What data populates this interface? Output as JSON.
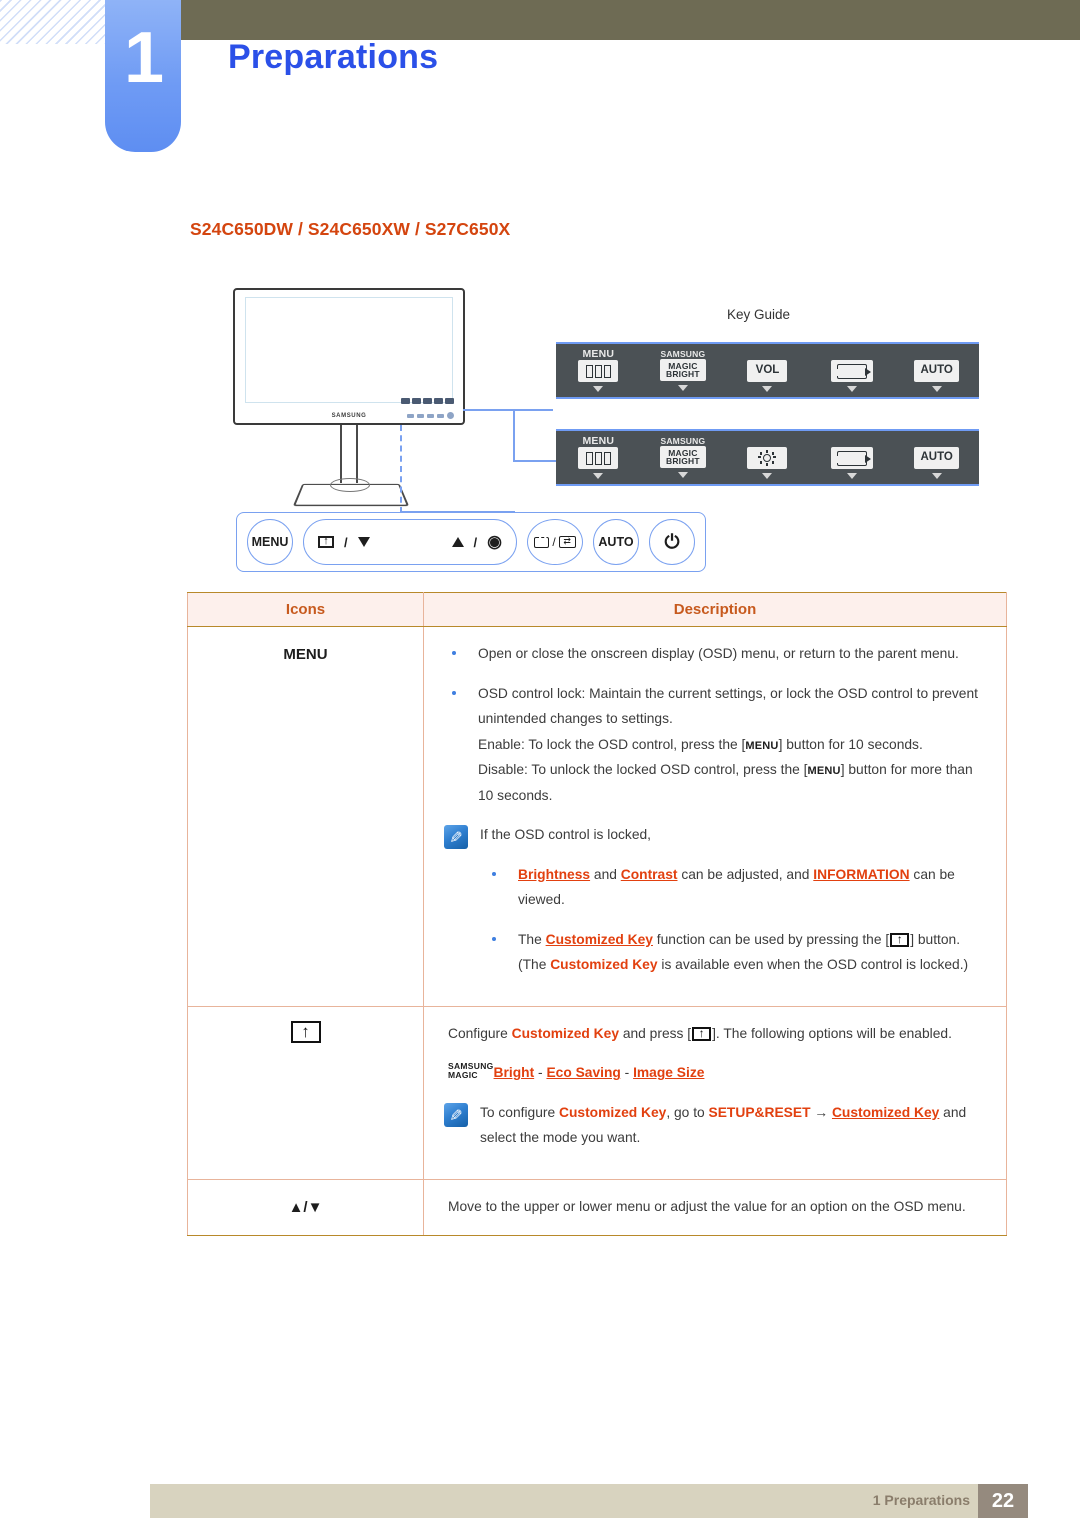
{
  "header": {
    "chapter_number": "1",
    "chapter_title": "Preparations"
  },
  "model_title": "S24C650DW / S24C650XW / S27C650X",
  "monitor": {
    "brand": "SAMSUNG"
  },
  "key_guide": {
    "label": "Key Guide",
    "panels": [
      {
        "id": "panel-vol",
        "cells": [
          {
            "caption": "MENU",
            "glyph": "window-icon",
            "box_text": ""
          },
          {
            "caption": "SAMSUNG",
            "glyph": "magic-bright-box",
            "box_text": "MAGIC BRIGHT"
          },
          {
            "caption": "",
            "glyph": "text-box",
            "box_text": "VOL"
          },
          {
            "caption": "",
            "glyph": "loop-icon",
            "box_text": ""
          },
          {
            "caption": "",
            "glyph": "text-box",
            "box_text": "AUTO"
          }
        ]
      },
      {
        "id": "panel-bright",
        "cells": [
          {
            "caption": "MENU",
            "glyph": "window-icon",
            "box_text": ""
          },
          {
            "caption": "SAMSUNG",
            "glyph": "magic-bright-box",
            "box_text": "MAGIC BRIGHT"
          },
          {
            "caption": "",
            "glyph": "brightness-sun-icon",
            "box_text": ""
          },
          {
            "caption": "",
            "glyph": "loop-icon",
            "box_text": ""
          },
          {
            "caption": "",
            "glyph": "text-box",
            "box_text": "AUTO"
          }
        ]
      }
    ],
    "magic_line1": "MAGIC",
    "magic_line2": "BRIGHT",
    "samsung_small": "SAMSUNG",
    "vol_label": "VOL",
    "auto_label": "AUTO"
  },
  "button_bar": {
    "menu": "MENU",
    "auto": "AUTO",
    "power_glyph": "⏻",
    "separator": "/"
  },
  "table": {
    "headers": {
      "icons": "Icons",
      "description": "Description"
    },
    "rows": [
      {
        "icon_label": "MENU",
        "bullets": [
          "Open or close the onscreen display (OSD) menu, or return to the parent menu."
        ],
        "bullet2_lead": "OSD control lock: Maintain the current settings, or lock the OSD control to prevent unintended changes to settings.",
        "enable_pre": "Enable: To lock the OSD control, press the [",
        "enable_kbd": "MENU",
        "enable_post": "] button for 10 seconds.",
        "disable_pre": "Disable: To unlock the locked OSD control, press the [",
        "disable_kbd": "MENU",
        "disable_post": "] button for more than 10 seconds.",
        "note_intro": "If the OSD control is locked,",
        "note_b1_p1": "",
        "note_b1_brightness": "Brightness",
        "note_b1_p2": " and ",
        "note_b1_contrast": "Contrast",
        "note_b1_p3": " can be adjusted, and ",
        "note_b1_information": "INFORMATION",
        "note_b1_p4": " can be viewed.",
        "note_b2_p1": "The ",
        "note_b2_ckey": "Customized Key",
        "note_b2_p2": " function can be used by pressing the [",
        "note_b2_p3": "] button. (The ",
        "note_b2_ckey2": "Customized Key",
        "note_b2_p4": " is available even when the OSD control is locked.)"
      },
      {
        "icon_label": "customized-key-icon",
        "line1_p1": "Configure ",
        "line1_ckey": "Customized Key",
        "line1_p2": " and press [",
        "line1_p3": "]. The following options will be enabled.",
        "magic_l1": "SAMSUNG",
        "magic_l2": "MAGIC",
        "opt1": "Bright",
        "opt_sep": " - ",
        "opt2": "Eco Saving",
        "opt3": "Image Size",
        "note_p1": "To configure ",
        "note_ckey": "Customized Key",
        "note_p2": ", go to ",
        "note_setup": "SETUP&RESET",
        "note_arrow": " → ",
        "note_ckey2": "Customized Key",
        "note_p3": " and select the mode you want."
      },
      {
        "icon_label": "▲/▼",
        "description": "Move to the upper or lower menu or adjust the value for an option on the OSD menu."
      }
    ]
  },
  "footer": {
    "chapter_ref": "1 Preparations",
    "page_number": "22"
  },
  "colors": {
    "chapter_blue": "#2b50e8",
    "olive": "#6e6b54",
    "model_orange": "#d4450f",
    "highlight_orange": "#e2400f",
    "table_border": "#e8b49b",
    "table_header_bg": "#fdf0ec",
    "footer_beige": "#d8d3bf",
    "footer_page_bg": "#958a7e",
    "panel_dark": "#4b5155"
  }
}
